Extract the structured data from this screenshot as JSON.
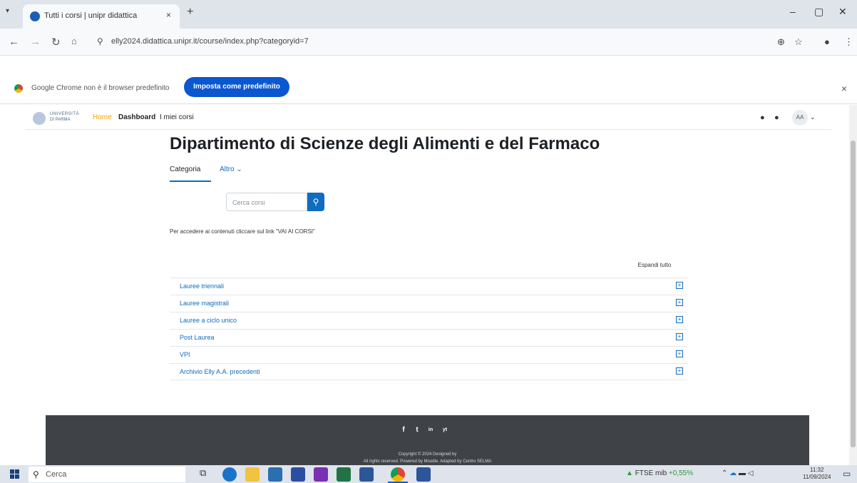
{
  "browser": {
    "tab_title": "Tutti i corsi | unipr didattica",
    "url": "elly2024.didattica.unipr.it/course/index.php?categoryid=7",
    "tab_close": "×",
    "new_tab": "+",
    "minimize": "–",
    "maximize": "▢",
    "close": "✕"
  },
  "infobar": {
    "message": "Google Chrome non è il browser predefinito",
    "button_label": "Imposta come predefinito",
    "close": "×"
  },
  "moodle_nav": {
    "logo_line1": "UNIVERSITÀ",
    "logo_line2": "DI PARMA",
    "links": [
      "Home",
      "Dashboard",
      "I miei corsi"
    ],
    "avatar_initials": "AA"
  },
  "page": {
    "title": "Dipartimento di Scienze degli Alimenti e del Farmaco",
    "secondary_nav": [
      "Categoria",
      "Altro ⌄"
    ],
    "search_placeholder": "Cerca corsi",
    "hint": "Per accedere ai contenuti cliccare sul link \"VAI AI CORSI\"",
    "expand_all": "Espandi tutto",
    "categories": [
      "Lauree triennali",
      "Lauree magistrali",
      "Lauree a ciclo unico",
      "Post Laurea",
      "VPI",
      "Archivio Elly A.A. precedenti"
    ]
  },
  "footer": {
    "social": [
      "f",
      "t",
      "in",
      "yt"
    ],
    "copyright": "Copyright © 2024 Designed by",
    "powered": "All rights reserved. Powered by Moodle. Adapted by Centro SELMA"
  },
  "taskbar": {
    "search_label": "Cerca",
    "ticker_name": "FTSE mib",
    "ticker_change": "+0,55%",
    "time": "11:32",
    "date": "11/09/2024"
  },
  "colors": {
    "accent": "#0f6cbf",
    "chrome_button": "#0b57d0",
    "footer_bg": "#3f4347",
    "home_link": "#f0a500"
  }
}
